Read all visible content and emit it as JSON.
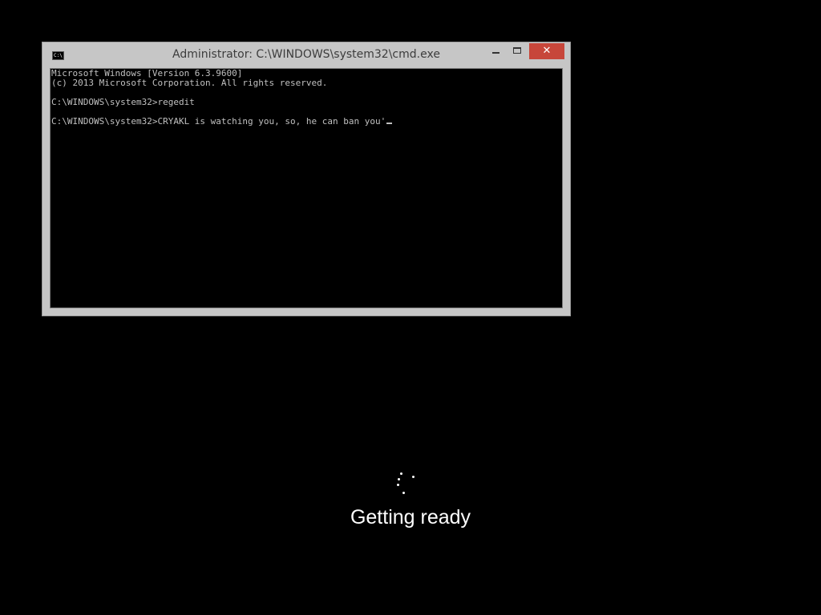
{
  "window": {
    "title": "Administrator: C:\\WINDOWS\\system32\\cmd.exe",
    "icon": "cmd-icon",
    "icon_text": "C:\\.",
    "controls": {
      "minimize": "minimize-icon",
      "maximize": "maximize-icon",
      "close_label": "✕"
    },
    "colors": {
      "frame": "#c6c6c6",
      "close": "#c7463a",
      "console_background": "#000000",
      "console_text": "#c0c0c0"
    }
  },
  "console": {
    "lines": [
      "Microsoft Windows [Version 6.3.9600]",
      "(c) 2013 Microsoft Corporation. All rights reserved.",
      "",
      "C:\\WINDOWS\\system32>regedit",
      "",
      "C:\\WINDOWS\\system32>CRYAKL is watching you, so, he can ban you'"
    ]
  },
  "boot": {
    "spinner": "loading-spinner-icon",
    "status_text": "Getting ready"
  }
}
